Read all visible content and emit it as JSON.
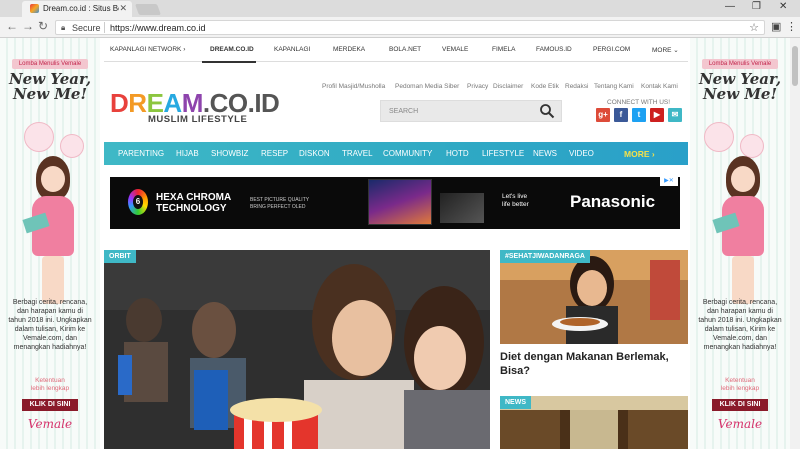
{
  "browser": {
    "tab_title": "Dream.co.id : Situs Berita",
    "secure_label": "Secure",
    "url": "https://www.dream.co.id"
  },
  "topnav": [
    {
      "label": "KAPANLAGI NETWORK ›",
      "active": false
    },
    {
      "label": "DREAM.CO.ID",
      "active": true
    },
    {
      "label": "KAPANLAGI",
      "active": false
    },
    {
      "label": "MERDEKA",
      "active": false
    },
    {
      "label": "BOLA.NET",
      "active": false
    },
    {
      "label": "VEMALE",
      "active": false
    },
    {
      "label": "FIMELA",
      "active": false
    },
    {
      "label": "FAMOUS.ID",
      "active": false
    },
    {
      "label": "PERGI.COM",
      "active": false
    },
    {
      "label": "MORE ⌄",
      "active": false
    }
  ],
  "logo": {
    "letters": [
      {
        "ch": "D",
        "color": "#e8413c"
      },
      {
        "ch": "R",
        "color": "#f39a25"
      },
      {
        "ch": "E",
        "color": "#8cc63f"
      },
      {
        "ch": "A",
        "color": "#27a9e1"
      },
      {
        "ch": "M",
        "color": "#8e44ad"
      },
      {
        "ch": ".",
        "color": "#555555"
      },
      {
        "ch": "CO.ID",
        "color": "#555555"
      }
    ],
    "tagline": "MUSLIM LIFESTYLE"
  },
  "top_links": [
    "Profil Masjid/Musholla",
    "Pedoman Media Siber",
    "Privacy",
    "Disclaimer",
    "Kode Etik",
    "Redaksi",
    "Tentang Kami",
    "Kontak Kami"
  ],
  "search": {
    "placeholder": "SEARCH"
  },
  "connect_label": "CONNECT WITH US!",
  "social": [
    {
      "name": "google-plus",
      "glyph": "g+",
      "color": "#dd4b39"
    },
    {
      "name": "facebook",
      "glyph": "f",
      "color": "#3b5998"
    },
    {
      "name": "twitter",
      "glyph": "t",
      "color": "#1da1f2"
    },
    {
      "name": "youtube",
      "glyph": "▶",
      "color": "#cd201f"
    },
    {
      "name": "email",
      "glyph": "✉",
      "color": "#3fb8c6"
    }
  ],
  "categories": [
    "PARENTING",
    "HIJAB",
    "SHOWBIZ",
    "RESEP",
    "DISKON",
    "TRAVEL",
    "COMMUNITY",
    "HOTD",
    "LIFESTYLE",
    "NEWS",
    "VIDEO"
  ],
  "more_label": "MORE ›",
  "banner": {
    "badge": "6",
    "headline": "HEXA CHROMA\nTECHNOLOGY",
    "sub": "BEST PICTURE QUALITY\nBRING PERFECT OLED",
    "slogan": "Let's live\nlife better",
    "brand": "Panasonic"
  },
  "side_ad": {
    "contest": "Lomba Menulis Vemale",
    "headline": "New Year,\nNew Me!",
    "body": "Berbagi cerita, rencana, dan harapan kamu di tahun 2018 ini. Ungkapkan dalam tulisan, Kirim ke Vemale.com, dan menangkan hadiahnya!",
    "terms": "Ketentuan\nlebih lengkap",
    "cta": "KLIK DI SINI",
    "brand": "Vemale"
  },
  "articles": {
    "hero_tag": "ORBIT",
    "card2_tag": "#SEHATJIWADANRAGA",
    "card2_title": "Diet dengan Makanan Berlemak, Bisa?",
    "card3_tag": "NEWS"
  }
}
